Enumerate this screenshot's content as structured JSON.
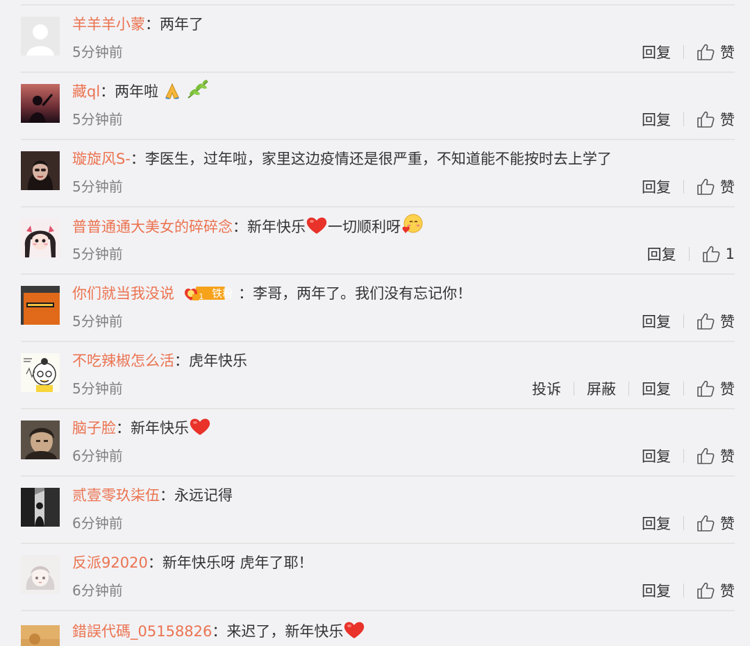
{
  "comments": [
    {
      "username": "羊羊羊小蒙",
      "text": "两年了",
      "time": "5分钟前",
      "actions": {
        "reply": "回复",
        "like": "赞"
      },
      "avatar_icon": "default-user-silhouette"
    },
    {
      "username": "藏ql",
      "text": "两年啦",
      "emojis": [
        "pray-emoji",
        "olive-branch-emoji"
      ],
      "time": "5分钟前",
      "actions": {
        "reply": "回复",
        "like": "赞"
      },
      "avatar_icon": "sunset-silhouette-photo"
    },
    {
      "username": "璇旋风S-",
      "text": "李医生，过年啦，家里这边疫情还是很严重，不知道能不能按时去上学了",
      "time": "5分钟前",
      "actions": {
        "reply": "回复",
        "like": "赞"
      },
      "avatar_icon": "portrait-photo"
    },
    {
      "username": "普普通通大美女的碎碎念",
      "text_before": "新年快乐",
      "text_after": "一切顺利呀",
      "emojis": [
        "heart-emoji",
        "hugging-face-emoji"
      ],
      "time": "5分钟前",
      "actions": {
        "reply": "回复",
        "like": "1"
      },
      "avatar_icon": "anime-girl-drawing"
    },
    {
      "username": "你们就当我没说",
      "badge": {
        "text": "铁粉",
        "level": "1"
      },
      "text": "李哥，两年了。我们没有忘记你！",
      "time": "5分钟前",
      "actions": {
        "reply": "回复",
        "like": "赞"
      },
      "avatar_icon": "orange-sign-photo"
    },
    {
      "username": "不吃辣椒怎么活",
      "text": "虎年快乐",
      "time": "5分钟前",
      "actions": {
        "report": "投诉",
        "block": "屏蔽",
        "reply": "回复",
        "like": "赞"
      },
      "avatar_icon": "cartoon-face-drawing"
    },
    {
      "username": "脑子脸",
      "text": "新年快乐",
      "emojis": [
        "heart-emoji"
      ],
      "time": "6分钟前",
      "actions": {
        "reply": "回复",
        "like": "赞"
      },
      "avatar_icon": "dark-portrait-photo"
    },
    {
      "username": "贰壹零玖柒伍",
      "text": "永远记得",
      "time": "6分钟前",
      "actions": {
        "reply": "回复",
        "like": "赞"
      },
      "avatar_icon": "black-white-photo"
    },
    {
      "username": "反派92020",
      "text": "新年快乐呀 虎年了耶！",
      "time": "6分钟前",
      "actions": {
        "reply": "回复",
        "like": "赞"
      },
      "avatar_icon": "light-anime-drawing"
    },
    {
      "username": "錯誤代碼_05158826",
      "text": "来迟了，新年快乐",
      "emojis": [
        "heart-emoji"
      ],
      "time": "",
      "actions": {},
      "avatar_icon": "warm-photo"
    }
  ],
  "separator": "：",
  "colors": {
    "username": "#eb7350",
    "text": "#333333",
    "time": "#808080",
    "background": "#f2f2f5",
    "divider": "#e4e4e4"
  }
}
